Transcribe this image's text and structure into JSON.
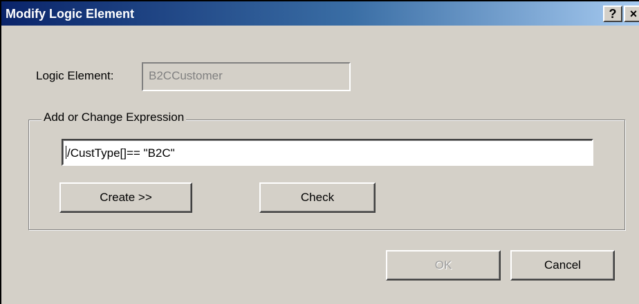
{
  "window": {
    "title": "Modify Logic Element",
    "help_glyph": "?",
    "close_glyph": "×"
  },
  "logic_element": {
    "label": "Logic Element:",
    "value": "B2CCustomer",
    "disabled": true
  },
  "expression_group": {
    "legend": "Add or Change Expression",
    "expression_value": "/CustType[]== \"B2C\"",
    "create_label": "Create >>",
    "check_label": "Check"
  },
  "footer": {
    "ok_label": "OK",
    "ok_disabled": true,
    "cancel_label": "Cancel"
  },
  "colors": {
    "dialog_face": "#d4d0c8",
    "title_start": "#0a246a",
    "title_end": "#a6caf0"
  }
}
